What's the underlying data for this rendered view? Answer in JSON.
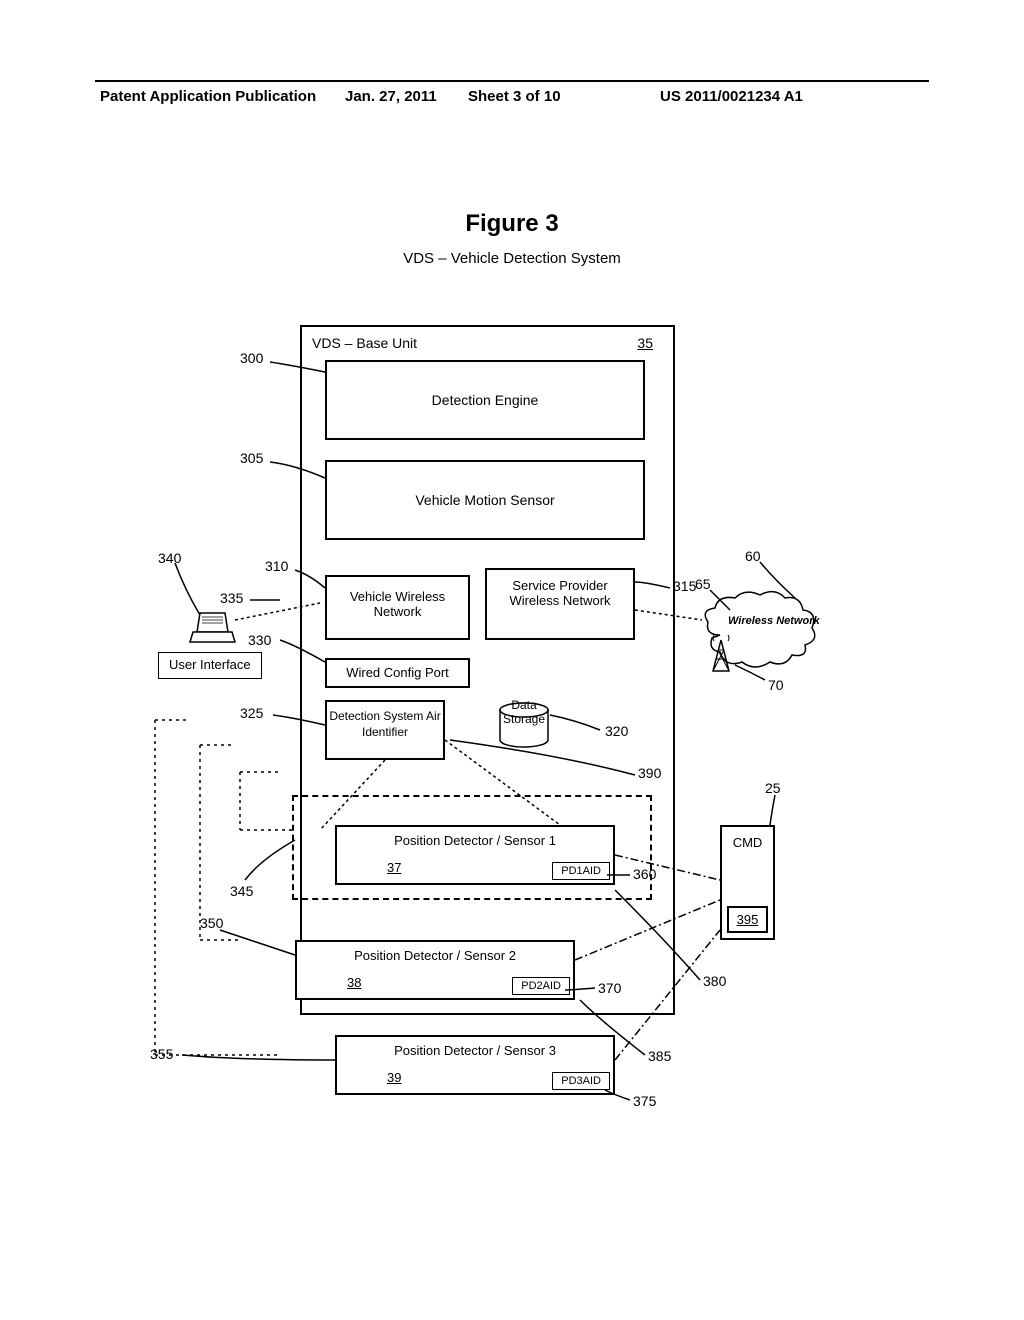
{
  "header": {
    "left": "Patent Application Publication",
    "date": "Jan. 27, 2011",
    "sheet": "Sheet 3 of 10",
    "right": "US 2011/0021234 A1"
  },
  "figure": {
    "title": "Figure 3",
    "subtitle": "VDS – Vehicle Detection System"
  },
  "vds_base": {
    "title": "VDS – Base Unit",
    "num": "35"
  },
  "blocks": {
    "detection_engine": "Detection Engine",
    "motion_sensor": "Vehicle Motion Sensor",
    "vwn": "Vehicle Wireless Network",
    "spwn": "Service Provider Wireless Network",
    "wired_port": "Wired Config Port",
    "air_id": "Detection System Air Identifier",
    "data_storage": "Data Storage",
    "cmd": "CMD",
    "cmd_num": "395",
    "wireless_network": "Wireless Network",
    "user_interface": "User Interface"
  },
  "position_detectors": {
    "pd1": {
      "title": "Position Detector / Sensor 1",
      "num": "37",
      "aid": "PD1AID"
    },
    "pd2": {
      "title": "Position Detector / Sensor 2",
      "num": "38",
      "aid": "PD2AID"
    },
    "pd3": {
      "title": "Position Detector / Sensor 3",
      "num": "39",
      "aid": "PD3AID"
    }
  },
  "refs": {
    "r300": "300",
    "r305": "305",
    "r310": "310",
    "r315": "315",
    "r320": "320",
    "r325": "325",
    "r330": "330",
    "r335": "335",
    "r340": "340",
    "r345": "345",
    "r350": "350",
    "r355": "355",
    "r360": "360",
    "r370": "370",
    "r375": "375",
    "r380": "380",
    "r385": "385",
    "r390": "390",
    "r60": "60",
    "r65": "65",
    "r70": "70",
    "r25": "25"
  }
}
